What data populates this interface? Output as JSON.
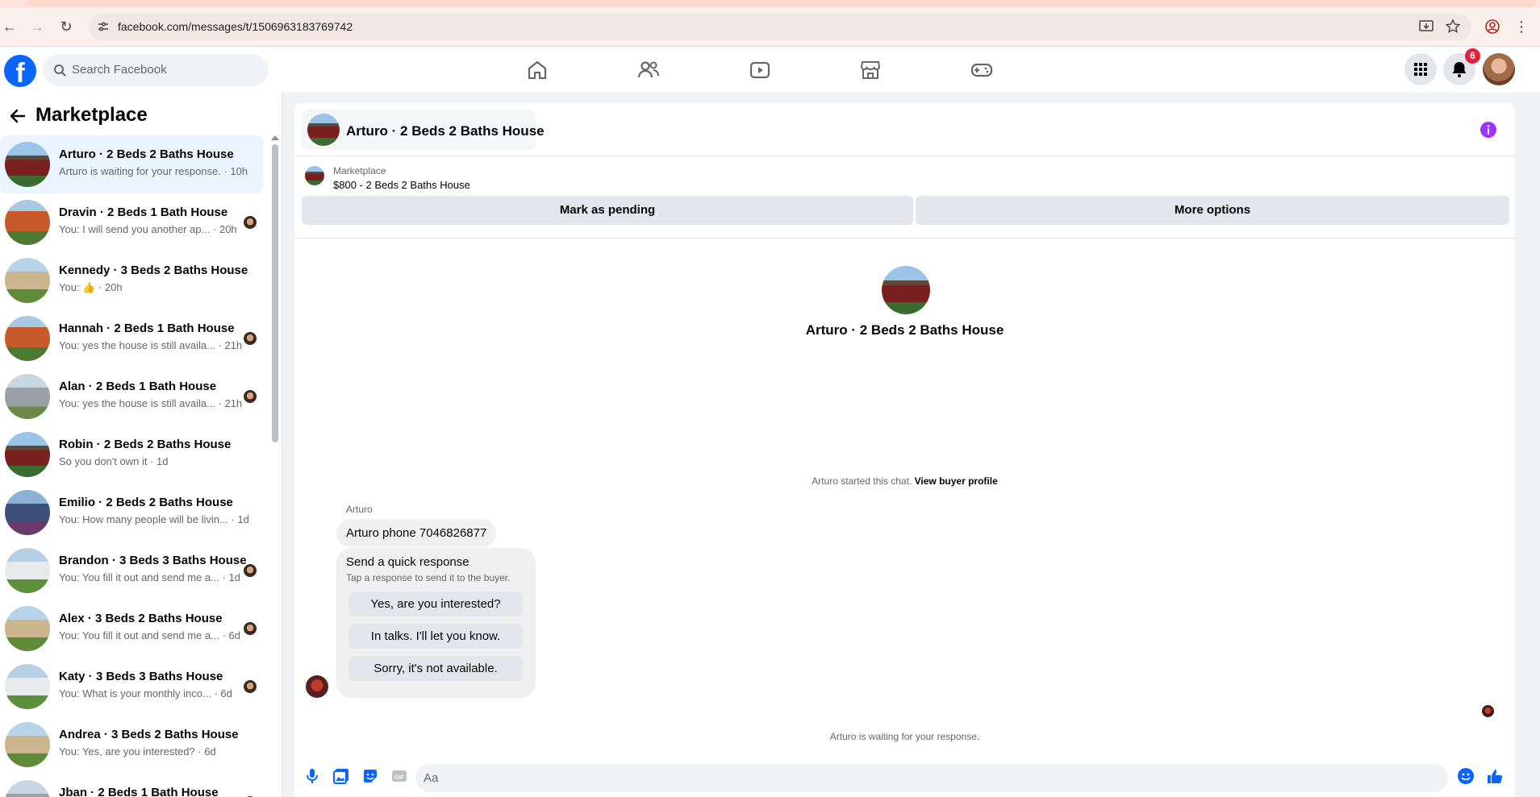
{
  "browser": {
    "url": "facebook.com/messages/t/1506963183769742"
  },
  "header": {
    "logo": "f",
    "search_placeholder": "Search Facebook",
    "notification_count": "6"
  },
  "sidebar": {
    "title": "Marketplace",
    "conversations": [
      {
        "name": "Arturo · 2 Beds 2 Baths House",
        "preview": "Arturo is waiting for your response. · 10h",
        "thumb": "red-house"
      },
      {
        "name": "Dravin · 2 Beds 1 Bath House",
        "preview": "You: I will send you another ap... · 20h",
        "thumb": "orange-house"
      },
      {
        "name": "Kennedy · 3 Beds 2 Baths House",
        "preview": "You: 👍 · 20h",
        "thumb": "tan-house"
      },
      {
        "name": "Hannah · 2 Beds 1 Bath House",
        "preview": "You: yes the house is still availa... · 21h",
        "thumb": "orange-house"
      },
      {
        "name": "Alan · 2 Beds 1 Bath House",
        "preview": "You: yes the house is still availa... · 21h",
        "thumb": "gray-house"
      },
      {
        "name": "Robin · 2 Beds 2 Baths House",
        "preview": "So you don't own it · 1d",
        "thumb": "red-house"
      },
      {
        "name": "Emilio · 2 Beds 2 Baths House",
        "preview": "You: How many people will be livin... · 1d",
        "thumb": "blue-house"
      },
      {
        "name": "Brandon · 3 Beds 3 Baths House",
        "preview": "You: You fill it out and send me a... · 1d",
        "thumb": "white-house"
      },
      {
        "name": "Alex · 3 Beds 2 Baths House",
        "preview": "You: You fill it out and send me a... · 6d",
        "thumb": "tan-house"
      },
      {
        "name": "Katy · 3 Beds 3 Baths House",
        "preview": "You: What is your monthly inco... · 6d",
        "thumb": "white-house"
      },
      {
        "name": "Andrea · 3 Beds 2 Baths House",
        "preview": "You: Yes, are you interested? · 6d",
        "thumb": "tan-house"
      },
      {
        "name": "Jban · 2 Beds 1 Bath House",
        "preview": "",
        "thumb": "gray-house"
      }
    ]
  },
  "chat": {
    "title": "Arturo · 2 Beds 2 Baths House",
    "listing_label": "Marketplace",
    "listing_price": "$800 - 2 Beds 2 Baths House",
    "mark_pending": "Mark as pending",
    "more_options": "More options",
    "center_name": "Arturo · 2 Beds 2 Baths House",
    "started_text": "Arturo started this chat.",
    "view_profile": "View buyer profile",
    "sender": "Arturo",
    "message": "Arturo phone 7046826877",
    "quick_title": "Send a quick response",
    "quick_subtitle": "Tap a response to send it to the buyer.",
    "quick_replies": [
      "Yes, are you interested?",
      "In talks. I'll let you know.",
      "Sorry, it's not available."
    ],
    "waiting": "Arturo is waiting for your response.",
    "input_placeholder": "Aa"
  },
  "colors": {
    "brand": "#0866ff",
    "messenger_purple": "#a033ff",
    "badge_red": "#e41e3f"
  }
}
